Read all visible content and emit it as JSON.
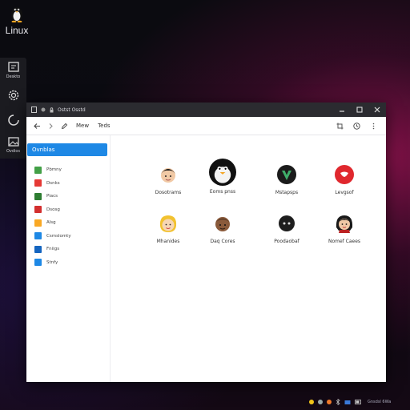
{
  "desktop": {
    "logo_text": "Linux"
  },
  "dock": {
    "items": [
      {
        "label": "Deskto"
      },
      {
        "label": ""
      },
      {
        "label": ""
      },
      {
        "label": "Ovdios"
      }
    ]
  },
  "window": {
    "title": "Ostst Osstd",
    "toolbar": {
      "item1": "Mew",
      "item2": "Teds"
    },
    "sidebar": {
      "header": "Ovnblas",
      "items": [
        {
          "label": "Pbmny",
          "color": "#43a047"
        },
        {
          "label": "Dsnks",
          "color": "#e53935"
        },
        {
          "label": "Piacs",
          "color": "#2e7d32"
        },
        {
          "label": "Dsosg",
          "color": "#d32f2f"
        },
        {
          "label": "Alsg",
          "color": "#f9a825"
        },
        {
          "label": "Csmslomty",
          "color": "#1e88e5"
        },
        {
          "label": "Fniigs",
          "color": "#1565c0"
        },
        {
          "label": "Stnfy",
          "color": "#1e88e5"
        }
      ]
    },
    "apps": [
      {
        "name": "Dosotrams",
        "icon": "avatar-dark-hair-icon"
      },
      {
        "name": "Eoms pnss",
        "icon": "tux-penguin-icon"
      },
      {
        "name": "Mstapsps",
        "icon": "green-v-logo-icon"
      },
      {
        "name": "Levgsof",
        "icon": "red-circle-logo-icon"
      },
      {
        "name": "Mhanides",
        "icon": "avatar-blonde-icon"
      },
      {
        "name": "Daq Cores",
        "icon": "avatar-brown-skin-icon"
      },
      {
        "name": "Poodaobaf",
        "icon": "dark-circle-badge-icon"
      },
      {
        "name": "Nomef Caees",
        "icon": "avatar-dark-hair-woman-icon"
      }
    ]
  },
  "tray": {
    "clock": "Gnsdsl 6Wa"
  }
}
